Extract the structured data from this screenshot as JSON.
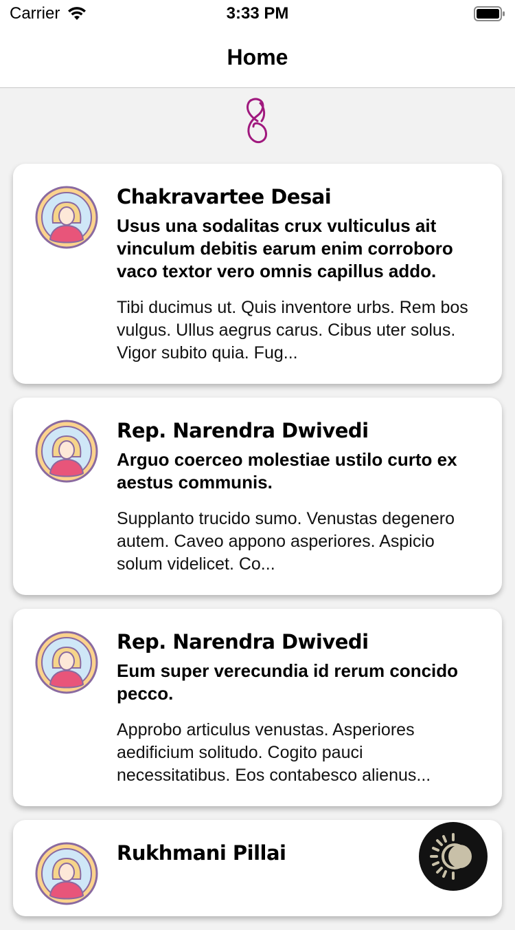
{
  "status_bar": {
    "carrier": "Carrier",
    "time": "3:33 PM",
    "wifi_icon": "wifi-icon",
    "battery_icon": "battery-icon"
  },
  "nav": {
    "title": "Home"
  },
  "logo": {
    "icon": "app-logo-icon",
    "color": "#a0197e"
  },
  "posts": [
    {
      "name": "Chakravartee Desai",
      "subject": "Usus una sodalitas crux vulticulus ait vinculum debitis earum enim corroboro vaco textor vero omnis capillus addo.",
      "body": "Tibi ducimus ut. Quis inventore urbs. Rem bos vulgus. Ullus aegrus carus. Cibus uter solus. Vigor subito quia. Fug..."
    },
    {
      "name": "Rep. Narendra Dwivedi",
      "subject": "Arguo coerceo molestiae ustilo curto ex aestus communis.",
      "body": "Supplanto trucido sumo. Venustas degenero autem. Caveo appono asperiores. Aspicio solum videlicet. Co..."
    },
    {
      "name": "Rep. Narendra Dwivedi",
      "subject": "Eum super verecundia id rerum concido pecco.",
      "body": "Approbo articulus venustas. Asperiores aedificium solitudo. Cogito pauci necessitatibus. Eos contabesco alienus..."
    },
    {
      "name": "Rukhmani Pillai",
      "subject": "",
      "body": ""
    }
  ],
  "theme_toggle": {
    "icon": "theme-toggle-icon"
  }
}
